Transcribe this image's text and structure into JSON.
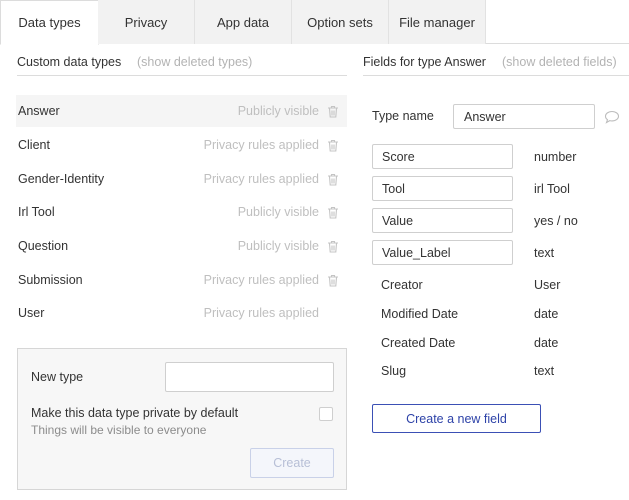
{
  "tabs": [
    {
      "label": "Data types",
      "active": true
    },
    {
      "label": "Privacy",
      "active": false
    },
    {
      "label": "App data",
      "active": false
    },
    {
      "label": "Option sets",
      "active": false
    },
    {
      "label": "File manager",
      "active": false
    }
  ],
  "left_panel": {
    "title": "Custom data types",
    "show_deleted": "(show deleted types)",
    "types": [
      {
        "name": "Answer",
        "status": "Publicly visible",
        "trash": true,
        "selected": true
      },
      {
        "name": "Client",
        "status": "Privacy rules applied",
        "trash": true
      },
      {
        "name": "Gender-Identity",
        "status": "Privacy rules applied",
        "trash": true
      },
      {
        "name": "Irl Tool",
        "status": "Publicly visible",
        "trash": true
      },
      {
        "name": "Question",
        "status": "Publicly visible",
        "trash": true
      },
      {
        "name": "Submission",
        "status": "Privacy rules applied",
        "trash": true
      },
      {
        "name": "User",
        "status": "Privacy rules applied",
        "trash": false
      }
    ],
    "new_type": {
      "label": "New type",
      "input_value": "",
      "private_label": "Make this data type private by default",
      "private_sub": "Things will be visible to everyone",
      "private_checked": false,
      "create_label": "Create"
    }
  },
  "right_panel": {
    "title": "Fields for type Answer",
    "show_deleted": "(show deleted fields)",
    "type_name_label": "Type name",
    "type_name_value": "Answer",
    "fields": [
      {
        "name": "Score",
        "type": "number",
        "editable": true
      },
      {
        "name": "Tool",
        "type": "irl Tool",
        "editable": true
      },
      {
        "name": "Value",
        "type": "yes / no",
        "editable": true
      },
      {
        "name": "Value_Label",
        "type": "text",
        "editable": true
      },
      {
        "name": "Creator",
        "type": "User",
        "editable": false
      },
      {
        "name": "Modified Date",
        "type": "date",
        "editable": false
      },
      {
        "name": "Created Date",
        "type": "date",
        "editable": false
      },
      {
        "name": "Slug",
        "type": "text",
        "editable": false
      }
    ],
    "create_field_label": "Create a new field"
  },
  "colors": {
    "accent": "#3b50b5",
    "muted_text": "#bfbfbf",
    "border": "#dcdcdc"
  },
  "icons": {
    "trash": "trash-icon",
    "comment": "comment-bubble-icon"
  }
}
